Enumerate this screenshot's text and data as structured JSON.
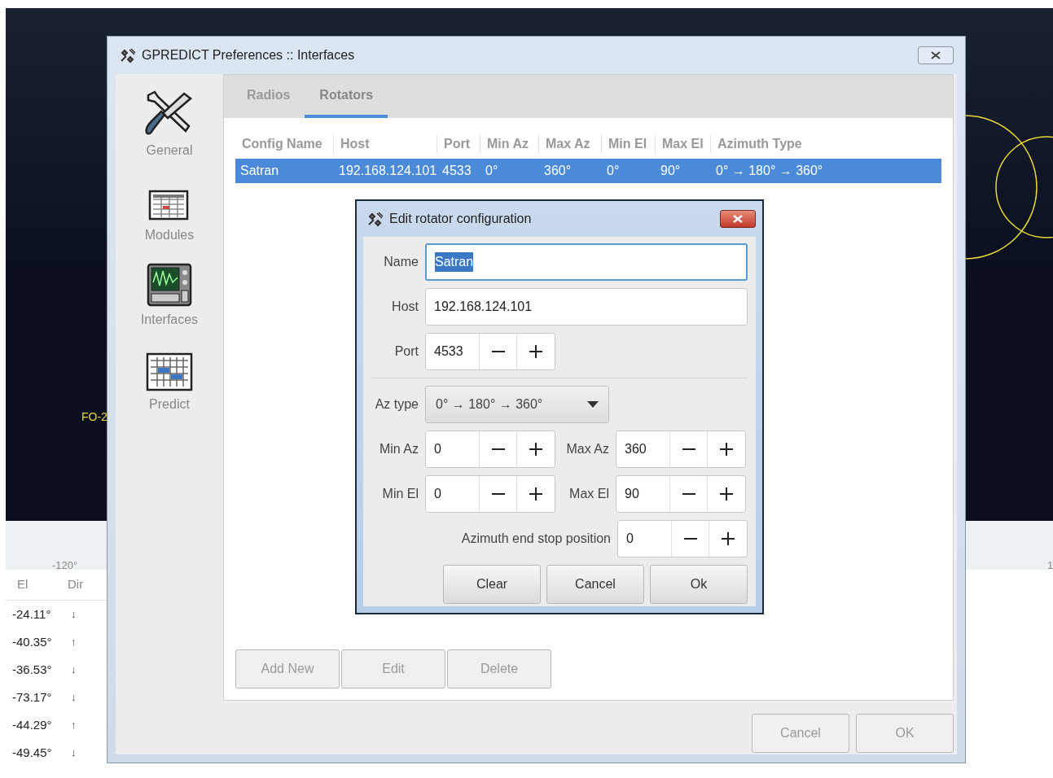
{
  "map": {
    "labels": [
      {
        "text": "FO-2",
        "kind": "satellite"
      },
      {
        "text": "-120°",
        "kind": "grid"
      },
      {
        "text": "1",
        "kind": "grid_right"
      }
    ]
  },
  "pass_table": {
    "columns": [
      "El",
      "Dir"
    ],
    "rows": [
      {
        "el": "-24.11°",
        "dir": "↓"
      },
      {
        "el": "-40.35°",
        "dir": "↑"
      },
      {
        "el": "-36.53°",
        "dir": "↓"
      },
      {
        "el": "-73.17°",
        "dir": "↓"
      },
      {
        "el": "-44.29°",
        "dir": "↑"
      },
      {
        "el": "-49.45°",
        "dir": "↓"
      }
    ]
  },
  "window": {
    "title": "GPREDICT Preferences :: Interfaces"
  },
  "sidebar": {
    "items": [
      {
        "label": "General",
        "kind": "tools"
      },
      {
        "label": "Modules",
        "kind": "modules"
      },
      {
        "label": "Interfaces",
        "kind": "interfaces"
      },
      {
        "label": "Predict",
        "kind": "predict"
      }
    ]
  },
  "tabs": [
    {
      "label": "Radios",
      "selected": false
    },
    {
      "label": "Rotators",
      "selected": true
    }
  ],
  "table": {
    "columns": [
      "Config Name",
      "Host",
      "Port",
      "Min Az",
      "Max Az",
      "Min El",
      "Max El",
      "Azimuth Type"
    ],
    "rows": [
      {
        "selected": true,
        "cells": [
          "Satran",
          "192.168.124.101",
          "4533",
          "0°",
          "360°",
          "0°",
          "90°",
          "0° → 180° → 360°"
        ]
      }
    ]
  },
  "buttons": [
    {
      "label": "Add New",
      "disabled": true
    },
    {
      "label": "Edit",
      "disabled": true
    },
    {
      "label": "Delete",
      "disabled": true
    }
  ],
  "footer_buttons": [
    {
      "label": "Cancel",
      "disabled": true
    },
    {
      "label": "OK",
      "disabled": true
    }
  ],
  "dialog": {
    "title": "Edit rotator configuration",
    "name": {
      "label": "Name",
      "value": "Satran",
      "focused": true
    },
    "host": {
      "label": "Host",
      "value": "192.168.124.101",
      "focused": false
    },
    "port": {
      "label": "Port",
      "value": "4533"
    },
    "az_type": {
      "label": "Az type",
      "value": "0° → 180° → 360°"
    },
    "min_az": {
      "label": "Min Az",
      "value": "0"
    },
    "max_az": {
      "label": "Max Az",
      "value": "360"
    },
    "min_el": {
      "label": "Min El",
      "value": "0"
    },
    "max_el": {
      "label": "Max El",
      "value": "90"
    },
    "end_stop": {
      "label": "Azimuth end stop position",
      "value": "0"
    },
    "buttons": [
      {
        "label": "Clear",
        "disabled": false
      },
      {
        "label": "Cancel",
        "disabled": false
      },
      {
        "label": "Ok",
        "disabled": false
      }
    ]
  }
}
